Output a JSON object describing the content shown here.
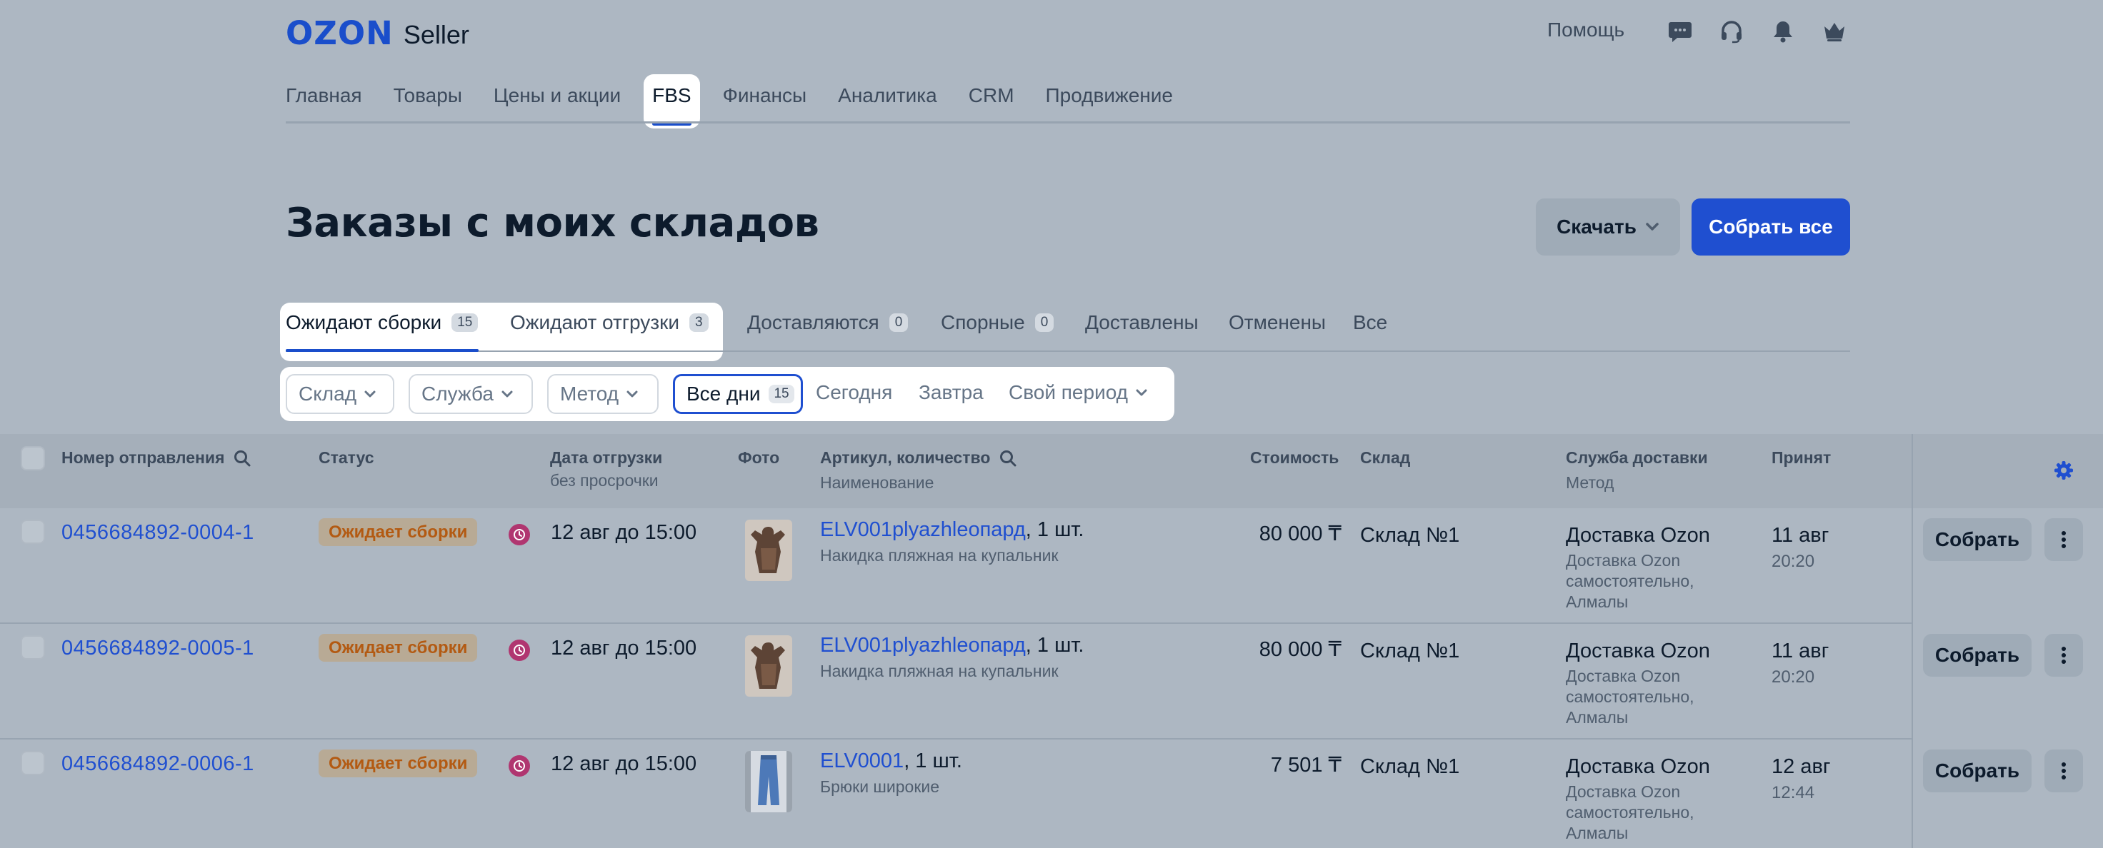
{
  "header": {
    "logo_brand": "OZON",
    "logo_product": "Seller",
    "help_label": "Помощь",
    "icons": [
      "chat-icon",
      "headset-icon",
      "bell-icon",
      "crown-icon"
    ]
  },
  "nav": {
    "items": [
      "Главная",
      "Товары",
      "Цены и акции",
      "FBS",
      "Финансы",
      "Аналитика",
      "CRM",
      "Продвижение"
    ],
    "active_item": "FBS"
  },
  "page": {
    "title": "Заказы с моих складов",
    "download_label": "Скачать",
    "collect_all_label": "Собрать все"
  },
  "status_tabs": [
    {
      "label": "Ожидают сборки",
      "count": "15"
    },
    {
      "label": "Ожидают отгрузки",
      "count": "3"
    },
    {
      "label": "Доставляются",
      "count": "0"
    },
    {
      "label": "Спорные",
      "count": "0"
    },
    {
      "label": "Доставлены"
    },
    {
      "label": "Отменены"
    },
    {
      "label": "Все"
    }
  ],
  "active_tab": "Ожидают сборки",
  "filters": {
    "warehouse": "Склад",
    "service": "Служба",
    "method": "Метод",
    "all_days": "Все дни",
    "all_days_count": "15",
    "today": "Сегодня",
    "tomorrow": "Завтра",
    "custom_period": "Свой период",
    "selected": "Все дни"
  },
  "table": {
    "columns": {
      "order_number": "Номер отправления",
      "status": "Статус",
      "ship_date": "Дата отгрузки",
      "ship_date_sub": "без просрочки",
      "photo": "Фото",
      "sku": "Артикул, количество",
      "sku_sub": "Наименование",
      "price": "Стоимость",
      "warehouse": "Склад",
      "delivery": "Служба доставки",
      "delivery_sub": "Метод",
      "accepted": "Принят"
    },
    "rows": [
      {
        "order": "0456684892-0004-1",
        "status": "Ожидает сборки",
        "ship_date": "12 авг до 15:00",
        "sku": "ELV001plyazhleопард",
        "qty": ", 1 шт.",
        "name": "Накидка пляжная на купальник",
        "price": "80 000 ₸",
        "warehouse": "Склад №1",
        "delivery": "Доставка Ozon",
        "delivery_method": "Доставка Ozon самостоятельно, Алмалы",
        "accepted_date": "11 авг",
        "accepted_time": "20:20",
        "action": "Собрать"
      },
      {
        "order": "0456684892-0005-1",
        "status": "Ожидает сборки",
        "ship_date": "12 авг до 15:00",
        "sku": "ELV001plyazhleопард",
        "qty": ", 1 шт.",
        "name": "Накидка пляжная на купальник",
        "price": "80 000 ₸",
        "warehouse": "Склад №1",
        "delivery": "Доставка Ozon",
        "delivery_method": "Доставка Ozon самостоятельно, Алмалы",
        "accepted_date": "11 авг",
        "accepted_time": "20:20",
        "action": "Собрать"
      },
      {
        "order": "0456684892-0006-1",
        "status": "Ожидает сборки",
        "ship_date": "12 авг до 15:00",
        "sku": "ELV0001",
        "qty": ", 1 шт.",
        "name": "Брюки широкие",
        "price": "7 501 ₸",
        "warehouse": "Склад №1",
        "delivery": "Доставка Ozon",
        "delivery_method": "Доставка Ozon самостоятельно, Алмалы",
        "accepted_date": "12 авг",
        "accepted_time": "12:44",
        "action": "Собрать"
      }
    ]
  },
  "colors": {
    "accent": "#1f4fd0",
    "status_text": "#b35a12",
    "clock": "#b03670"
  }
}
